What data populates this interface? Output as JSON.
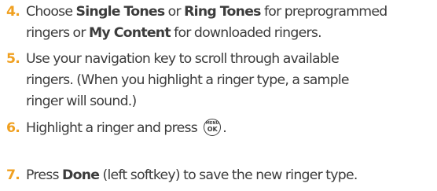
{
  "steps": [
    {
      "number": "4.",
      "line1": {
        "t1": "Choose ",
        "b1": "Single Tones",
        "t2": " or ",
        "b2": "Ring Tones",
        "t3": " for  preprogrammed"
      },
      "line2": {
        "t1": "ringers or ",
        "b1": "My Content",
        "t2": " for downloaded ringers."
      }
    },
    {
      "number": "5.",
      "lines": [
        "Use your navigation key to scroll through available",
        "ringers. (When you highlight a ringer type, a sample",
        "ringer will sound.)"
      ]
    },
    {
      "number": "6.",
      "text_before_key": "Highlight a ringer and press",
      "key": {
        "icon": "menu-ok-key-icon",
        "top": "MENU",
        "bottom": "OK"
      },
      "text_after_key": "."
    },
    {
      "number": "7.",
      "t1": "Press ",
      "b1": "Done",
      "t2": " (left softkey) to save the new ringer type."
    }
  ],
  "colors": {
    "number": "#f0a020",
    "text": "#3c3c3c"
  }
}
